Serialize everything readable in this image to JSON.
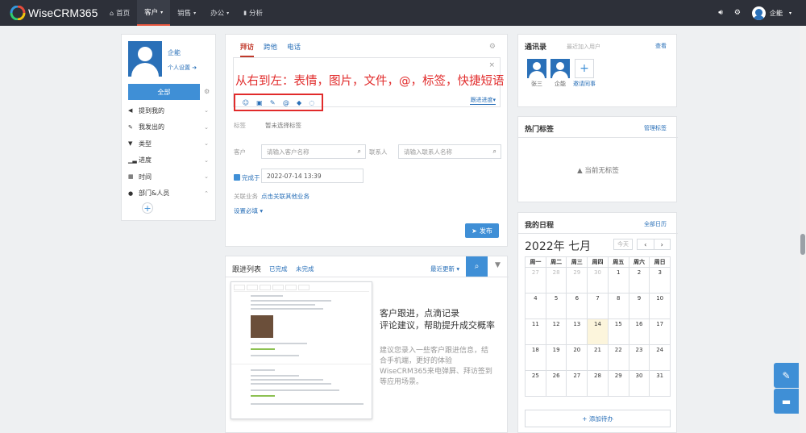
{
  "app": {
    "name": "WiseCRM365"
  },
  "nav": [
    {
      "label": "首页",
      "icon": "home-icon"
    },
    {
      "label": "客户",
      "icon": "",
      "caret": "▾"
    },
    {
      "label": "销售",
      "icon": "",
      "caret": "▾"
    },
    {
      "label": "办公",
      "icon": "",
      "caret": "▾"
    },
    {
      "label": "分析",
      "icon": "bar-chart-icon"
    }
  ],
  "user": {
    "name": "企能"
  },
  "left": {
    "name": "企能",
    "settings": "个人设置",
    "all": "全部",
    "menu": [
      "提到我的",
      "我发出的",
      "类型",
      "进度",
      "时间",
      "部门&人员"
    ]
  },
  "editor": {
    "tabs": [
      "拜访",
      "跨他",
      "电话"
    ],
    "annotation": "从右到左：表情，图片，文件，@，标签，快捷短语",
    "follow": "跟进进度▾",
    "tag_label": "标签",
    "tag_value": "暂未选择标签",
    "customer_label": "客户",
    "customer_placeholder": "请输入客户名称",
    "contact_label": "联系人",
    "contact_placeholder": "请输入联系人名称",
    "done_label": "完成于",
    "done_value": "2022-07-14 13:39",
    "related_label": "关联业务",
    "related_link": "点击关联其他业务",
    "settings_link": "设置必填 ▾",
    "publish": "发布"
  },
  "list": {
    "title": "跟进列表",
    "tabs": [
      "已完成",
      "未完成"
    ],
    "recent": "最近更新 ▾",
    "promo_title": [
      "客户跟进，点滴记录",
      "评论建议，帮助提升成交概率"
    ],
    "promo_body": [
      "建议您录入一些客户跟进信息，结",
      "合手机端，更好的体验",
      "WiseCRM365来电弹屏、拜访签到",
      "等应用场景。"
    ]
  },
  "contacts": {
    "title": "通讯录",
    "sub": "最近加入用户",
    "link": "查看",
    "people": [
      "张三",
      "企能"
    ],
    "invite": "邀请同事"
  },
  "tags": {
    "title": "热门标签",
    "link": "管理标签",
    "empty": "当前无标签"
  },
  "calendar": {
    "title": "我的日程",
    "link": "全部日历",
    "month": "2022年 七月",
    "today": "今天",
    "weekdays": [
      "周一",
      "周二",
      "周三",
      "周四",
      "周五",
      "周六",
      "周日"
    ],
    "weeks": [
      [
        "27",
        "28",
        "29",
        "30",
        "1",
        "2",
        "3"
      ],
      [
        "4",
        "5",
        "6",
        "7",
        "8",
        "9",
        "10"
      ],
      [
        "11",
        "12",
        "13",
        "14",
        "15",
        "16",
        "17"
      ],
      [
        "18",
        "19",
        "20",
        "21",
        "22",
        "23",
        "24"
      ],
      [
        "25",
        "26",
        "27",
        "28",
        "29",
        "30",
        "31"
      ]
    ],
    "today_date": "14",
    "add": "+ 添加待办"
  }
}
